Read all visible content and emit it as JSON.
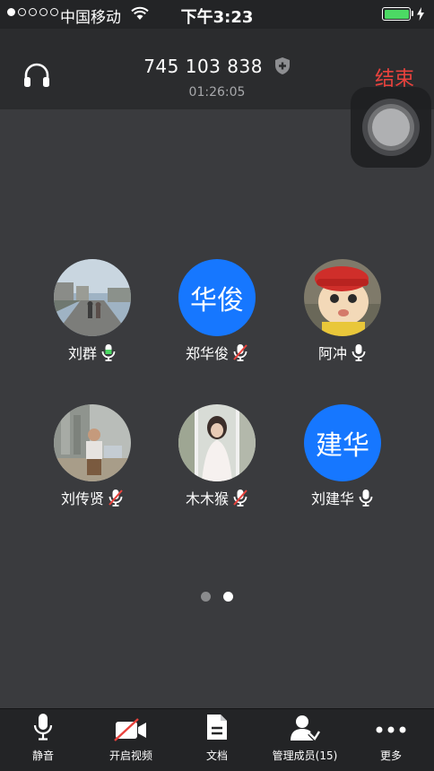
{
  "status_bar": {
    "carrier": "中国移动",
    "time": "下午3:23"
  },
  "header": {
    "meeting_id": "745 103 838",
    "duration": "01:26:05",
    "end_label": "结束"
  },
  "participants": [
    {
      "name": "刘群",
      "avatar_text": "",
      "mic": "active"
    },
    {
      "name": "郑华俊",
      "avatar_text": "华俊",
      "mic": "muted"
    },
    {
      "name": "阿冲",
      "avatar_text": "",
      "mic": "on"
    },
    {
      "name": "刘传贤",
      "avatar_text": "",
      "mic": "muted"
    },
    {
      "name": "木木猴",
      "avatar_text": "",
      "mic": "muted"
    },
    {
      "name": "刘建华",
      "avatar_text": "建华",
      "mic": "on"
    }
  ],
  "pagination": {
    "pages": 2,
    "current": 2
  },
  "toolbar": {
    "mute_label": "静音",
    "video_label": "开启视频",
    "docs_label": "文档",
    "members_label": "管理成员(15)",
    "more_label": "更多"
  },
  "colors": {
    "accent_blue": "#1677ff",
    "end_red": "#e9423d",
    "mic_active_green": "#4cd964",
    "mute_red": "#e9423d",
    "background": "#3a3b3e"
  }
}
